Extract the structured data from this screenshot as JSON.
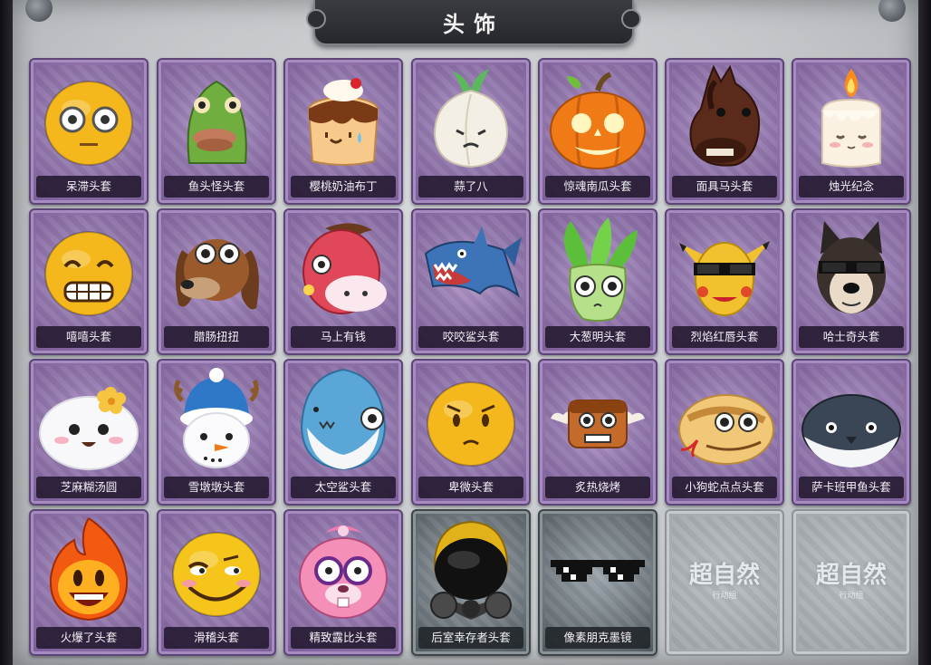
{
  "title": "头饰",
  "items": [
    {
      "label": "呆滞头套",
      "icon": "dazed-face-icon",
      "style": "purple"
    },
    {
      "label": "鱼头怪头套",
      "icon": "fish-head-icon",
      "style": "purple"
    },
    {
      "label": "樱桃奶油布丁",
      "icon": "pudding-icon",
      "style": "purple"
    },
    {
      "label": "蒜了八",
      "icon": "garlic-icon",
      "style": "purple"
    },
    {
      "label": "惊魂南瓜头套",
      "icon": "pumpkin-icon",
      "style": "purple"
    },
    {
      "label": "面具马头套",
      "icon": "horse-head-icon",
      "style": "purple"
    },
    {
      "label": "烛光纪念",
      "icon": "candle-icon",
      "style": "purple"
    },
    {
      "label": "嘻嘻头套",
      "icon": "grinning-face-icon",
      "style": "purple"
    },
    {
      "label": "腊肠扭扭",
      "icon": "dachshund-icon",
      "style": "purple"
    },
    {
      "label": "马上有钱",
      "icon": "red-horse-icon",
      "style": "purple"
    },
    {
      "label": "咬咬鲨头套",
      "icon": "shark-icon",
      "style": "purple"
    },
    {
      "label": "大葱明头套",
      "icon": "green-onion-icon",
      "style": "purple"
    },
    {
      "label": "烈焰红唇头套",
      "icon": "yellow-mouse-sunglasses-icon",
      "style": "purple"
    },
    {
      "label": "哈士奇头套",
      "icon": "husky-icon",
      "style": "purple"
    },
    {
      "label": "芝麻糊汤圆",
      "icon": "rice-ball-icon",
      "style": "purple"
    },
    {
      "label": "雪墩墩头套",
      "icon": "snowman-icon",
      "style": "purple"
    },
    {
      "label": "太空鲨头套",
      "icon": "space-shark-icon",
      "style": "purple"
    },
    {
      "label": "卑微头套",
      "icon": "humble-face-icon",
      "style": "purple"
    },
    {
      "label": "炙热烧烤",
      "icon": "grilled-meat-icon",
      "style": "purple"
    },
    {
      "label": "小狗蛇点点头套",
      "icon": "snake-icon",
      "style": "purple"
    },
    {
      "label": "萨卡班甲鱼头套",
      "icon": "fish-icon",
      "style": "purple"
    },
    {
      "label": "火爆了头套",
      "icon": "fire-icon",
      "style": "purple"
    },
    {
      "label": "滑稽头套",
      "icon": "funny-face-icon",
      "style": "purple"
    },
    {
      "label": "精致露比头套",
      "icon": "pink-beaver-icon",
      "style": "purple"
    },
    {
      "label": "后室幸存者头套",
      "icon": "gas-mask-icon",
      "style": "grey"
    },
    {
      "label": "像素朋克墨镜",
      "icon": "pixel-sunglasses-icon",
      "style": "grey"
    },
    {
      "label": "",
      "icon": "empty-slot-icon",
      "style": "empty",
      "watermark": "超自然",
      "watermark_sub": "行动组"
    },
    {
      "label": "",
      "icon": "empty-slot-icon",
      "style": "empty",
      "watermark": "超自然",
      "watermark_sub": "行动组"
    }
  ]
}
